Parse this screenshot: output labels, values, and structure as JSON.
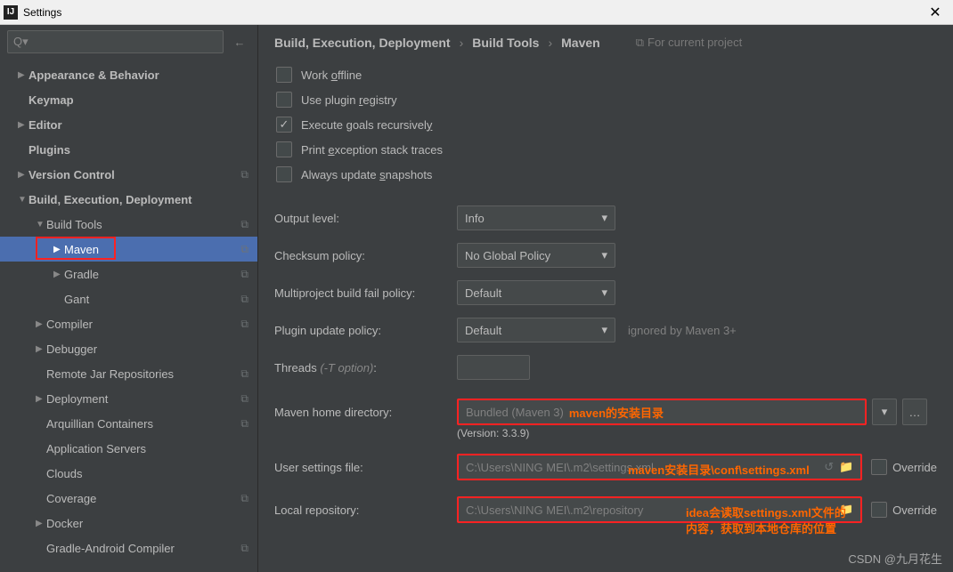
{
  "window": {
    "title": "Settings"
  },
  "search": {
    "placeholder": "Q▾"
  },
  "sidebar": {
    "items": [
      {
        "label": "Appearance & Behavior",
        "arrow": "closed",
        "level": 1,
        "bold": true,
        "copy": false
      },
      {
        "label": "Keymap",
        "arrow": "none",
        "level": 1,
        "bold": true,
        "copy": false
      },
      {
        "label": "Editor",
        "arrow": "closed",
        "level": 1,
        "bold": true,
        "copy": false
      },
      {
        "label": "Plugins",
        "arrow": "none",
        "level": 1,
        "bold": true,
        "copy": false
      },
      {
        "label": "Version Control",
        "arrow": "closed",
        "level": 1,
        "bold": true,
        "copy": true
      },
      {
        "label": "Build, Execution, Deployment",
        "arrow": "open",
        "level": 1,
        "bold": true,
        "copy": false
      },
      {
        "label": "Build Tools",
        "arrow": "open",
        "level": 2,
        "bold": false,
        "copy": true
      },
      {
        "label": "Maven",
        "arrow": "closed",
        "level": 3,
        "bold": false,
        "copy": true,
        "selected": true,
        "redbox": true
      },
      {
        "label": "Gradle",
        "arrow": "closed",
        "level": 3,
        "bold": false,
        "copy": true
      },
      {
        "label": "Gant",
        "arrow": "none",
        "level": 3,
        "bold": false,
        "copy": true
      },
      {
        "label": "Compiler",
        "arrow": "closed",
        "level": 2,
        "bold": false,
        "copy": true
      },
      {
        "label": "Debugger",
        "arrow": "closed",
        "level": 2,
        "bold": false,
        "copy": false
      },
      {
        "label": "Remote Jar Repositories",
        "arrow": "none",
        "level": 2,
        "bold": false,
        "copy": true
      },
      {
        "label": "Deployment",
        "arrow": "closed",
        "level": 2,
        "bold": false,
        "copy": true
      },
      {
        "label": "Arquillian Containers",
        "arrow": "none",
        "level": 2,
        "bold": false,
        "copy": true
      },
      {
        "label": "Application Servers",
        "arrow": "none",
        "level": 2,
        "bold": false,
        "copy": false
      },
      {
        "label": "Clouds",
        "arrow": "none",
        "level": 2,
        "bold": false,
        "copy": false
      },
      {
        "label": "Coverage",
        "arrow": "none",
        "level": 2,
        "bold": false,
        "copy": true
      },
      {
        "label": "Docker",
        "arrow": "closed",
        "level": 2,
        "bold": false,
        "copy": false
      },
      {
        "label": "Gradle-Android Compiler",
        "arrow": "none",
        "level": 2,
        "bold": false,
        "copy": true
      }
    ]
  },
  "breadcrumb": {
    "a": "Build, Execution, Deployment",
    "b": "Build Tools",
    "c": "Maven",
    "proj": "For current project"
  },
  "checks": {
    "offline": "Work offline",
    "registry": "Use plugin registry",
    "recursive": "Execute goals recursively",
    "exception": "Print exception stack traces",
    "snapshots": "Always update snapshots"
  },
  "form": {
    "output_level": "Output level:",
    "output_level_val": "Info",
    "checksum": "Checksum policy:",
    "checksum_val": "No Global Policy",
    "multiproject": "Multiproject build fail policy:",
    "multiproject_val": "Default",
    "plugin_update": "Plugin update policy:",
    "plugin_update_val": "Default",
    "plugin_hint": "ignored by Maven 3+",
    "threads": "Threads ",
    "threads_opt": "(-T option)",
    "maven_home": "Maven home directory:",
    "maven_home_val": "Bundled (Maven 3)",
    "version": "(Version: 3.3.9)",
    "user_settings": "User settings file:",
    "user_settings_val": "C:\\Users\\NING MEI\\.m2\\settings.xml",
    "local_repo": "Local repository:",
    "local_repo_val": "C:\\Users\\NING MEI\\.m2\\repository",
    "override": "Override"
  },
  "annotations": {
    "a1": "maven的安装目录",
    "a2": "maven安装目录\\conf\\settings.xml",
    "a3_l1": "idea会读取settings.xml文件的",
    "a3_l2": "内容，获取到本地仓库的位置"
  },
  "watermark": "CSDN @九月花生"
}
